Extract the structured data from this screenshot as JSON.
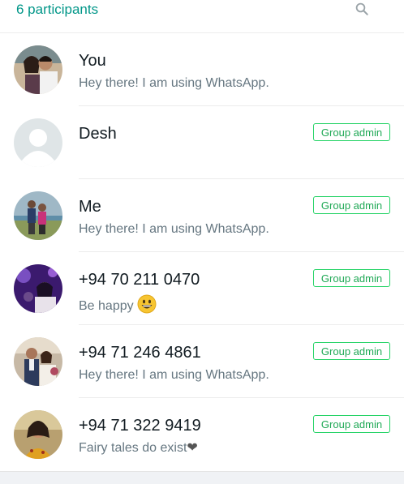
{
  "header": {
    "title": "6 participants",
    "search_icon": "search-icon"
  },
  "participants": [
    {
      "name": "You",
      "about": "Hey there! I am using WhatsApp.",
      "role": ""
    },
    {
      "name": "Desh",
      "about": "",
      "role": "Group admin"
    },
    {
      "name": "Me",
      "about": "Hey there! I am using WhatsApp.",
      "role": "Group admin"
    },
    {
      "name": "+94 70 211 0470",
      "about": "Be happy",
      "role": "Group admin"
    },
    {
      "name": "+94 71 246 4861",
      "about": "Hey there! I am using WhatsApp.",
      "role": "Group admin"
    },
    {
      "name": "+94 71 322 9419",
      "about": "Fairy tales do exist",
      "role": "Group admin"
    }
  ],
  "colors": {
    "accent": "#009688",
    "admin_badge": "#25d366",
    "primary_text": "#111b21",
    "secondary_text": "#667781"
  }
}
